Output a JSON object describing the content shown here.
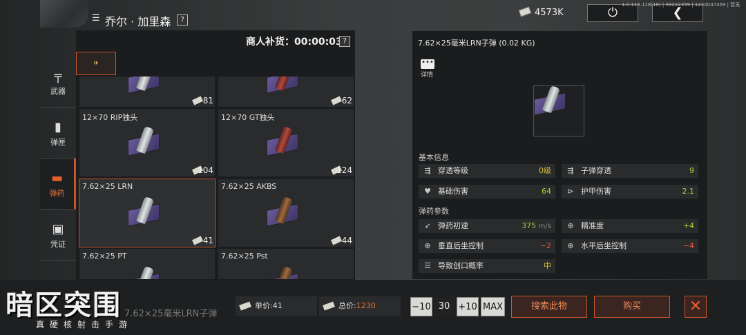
{
  "header": {
    "trader_icon": "menu-icon",
    "trader_name": "乔尔 · 加里森",
    "help": "?",
    "money": "4573K",
    "version": "1.0.118.118(16) | 09222359 | 1234047459 | 暂无"
  },
  "restock": {
    "label": "商人补货：00:00:03",
    "help": "?"
  },
  "categories": [
    {
      "label": "武器",
      "icon": "rifle-icon"
    },
    {
      "label": "弹匣",
      "icon": "magazine-icon"
    },
    {
      "label": "弹药",
      "icon": "bullet-icon",
      "active": true
    },
    {
      "label": "凭证",
      "icon": "voucher-icon"
    }
  ],
  "items": [
    {
      "name": "",
      "count": "81",
      "shell": "g"
    },
    {
      "name": "",
      "count": "62",
      "shell": "r"
    },
    {
      "name": "12×70 RIP独头",
      "count": "104",
      "shell": "g"
    },
    {
      "name": "12×70 GT独头",
      "count": "124",
      "shell": "r"
    },
    {
      "name": "7.62×25 LRN",
      "count": "41",
      "shell": "g",
      "selected": true
    },
    {
      "name": "7.62×25 AKBS",
      "count": "44",
      "shell": "b"
    },
    {
      "name": "7.62×25 PT",
      "count": "",
      "shell": "g"
    },
    {
      "name": "7.62×25 Pst",
      "count": "",
      "shell": "b"
    }
  ],
  "detail": {
    "title": "7.62×25毫米LRN子弹 (0.02 KG)",
    "more_label": "详情",
    "section1": "基本信息",
    "section2": "弹药参数",
    "stats1": [
      {
        "label": "穿透等级",
        "value": "0级",
        "color": "yel"
      },
      {
        "label": "子弹穿透",
        "value": "9",
        "color": "green"
      },
      {
        "label": "基础伤害",
        "value": "64",
        "color": "green"
      },
      {
        "label": "护甲伤害",
        "value": "2.1",
        "color": "green"
      }
    ],
    "stats2": [
      {
        "label": "弹药初速",
        "value": "375",
        "unit": "m/s",
        "color": "green"
      },
      {
        "label": "精准度",
        "value": "+4",
        "color": "green"
      },
      {
        "label": "垂直后坐控制",
        "value": "−2",
        "color": "red"
      },
      {
        "label": "水平后坐控制",
        "value": "−4",
        "color": "red"
      },
      {
        "label": "导致创口概率",
        "value": "中",
        "color": "yel"
      }
    ]
  },
  "bottom": {
    "logo": "暗区突围",
    "logo_sub": "真硬核射击手游",
    "selected_name": "7.62×25毫米LRN子弹",
    "unit_price": "单价:41",
    "total_label": "总价:",
    "total_value": "1230",
    "minus10": "−10",
    "qty": "30",
    "plus10": "+10",
    "max": "MAX",
    "search": "搜索此物",
    "buy": "购买",
    "close": "✕"
  }
}
